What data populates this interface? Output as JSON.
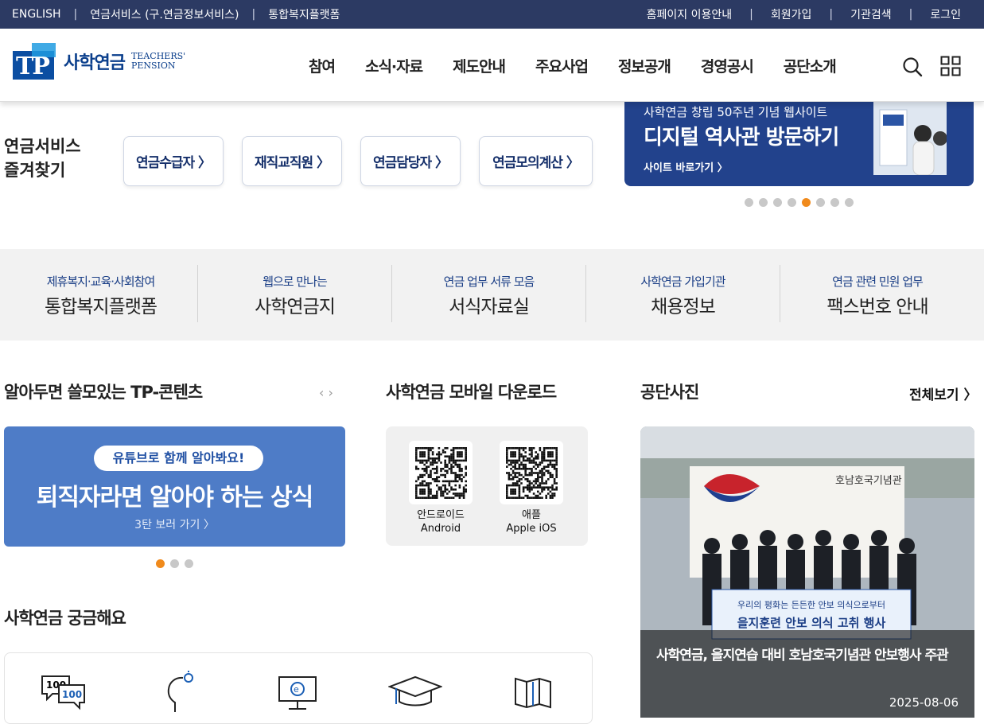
{
  "topbar": {
    "left": [
      "ENGLISH",
      "연금서비스 (구.연금정보서비스)",
      "통합복지플랫폼"
    ],
    "right": [
      "홈페이지 이용안내",
      "회원가입",
      "기관검색",
      "로그인"
    ]
  },
  "logo": {
    "mark": "TP",
    "name": "사학연금",
    "english_1": "TEACHERS'",
    "english_2": "PENSION"
  },
  "gnb": [
    "참여",
    "소식·자료",
    "제도안내",
    "주요사업",
    "정보공개",
    "경영공시",
    "공단소개"
  ],
  "header_icons": [
    "search-icon",
    "sitemap-grid-icon"
  ],
  "quick": {
    "title_1": "연금서비스",
    "title_2": "즐겨찾기",
    "buttons": [
      "연금수급자 〉",
      "재직교직원 〉",
      "연금담당자 〉",
      "연금모의계산 〉"
    ]
  },
  "banner": {
    "subtitle": "사학연금 창립 50주년 기념 웹사이트",
    "title": "디지털 역사관 방문하기",
    "link": "사이트 바로가기 〉",
    "slide_count": 8,
    "active_slide": 5
  },
  "strip": [
    {
      "sub": "제휴복지·교육·사회참여",
      "main": "통합복지플랫폼"
    },
    {
      "sub": "웹으로 만나는",
      "main": "사학연금지"
    },
    {
      "sub": "연금 업무 서류 모음",
      "main": "서식자료실"
    },
    {
      "sub": "사학연금 가입기관",
      "main": "채용정보"
    },
    {
      "sub": "연금 관련 민원 업무",
      "main": "팩스번호 안내"
    }
  ],
  "tp_contents": {
    "title": "알아두면 쓸모있는 TP-콘텐츠",
    "arrows": "‹ ›",
    "pill": "유튜브로 함께 알아봐요!",
    "headline": "퇴직자라면 알아야 하는 상식",
    "more": "3탄 보러 가기 〉",
    "slide_count": 3,
    "active_slide": 1
  },
  "mobile": {
    "title": "사학연금 모바일 다운로드",
    "apps": [
      {
        "label_1": "안드로이드",
        "label_2": "Android"
      },
      {
        "label_1": "애플",
        "label_2": "Apple iOS"
      }
    ]
  },
  "photos": {
    "title": "공단사진",
    "view_all": "전체보기 〉",
    "caption": "사학연금, 을지연습 대비 호남호국기념관 안보행사 주관",
    "date": "2025-08-06",
    "banner_text_1": "우리의 평화는 든든한 안보 의식으로부터",
    "banner_text_2": "을지훈련 안보 의식 고취 행사",
    "sign": "호남호국기념관"
  },
  "faq": {
    "title": "사학연금 궁금해요",
    "icons": [
      "100-speech-bubble-icon",
      "idea-head-icon",
      "e-monitor-icon",
      "graduation-cap-icon",
      "book-icon"
    ]
  },
  "colors": {
    "topbar": "#2c3a63",
    "accent_orange": "#f08a1c",
    "navy": "#16306b",
    "banner": "#22428c"
  }
}
